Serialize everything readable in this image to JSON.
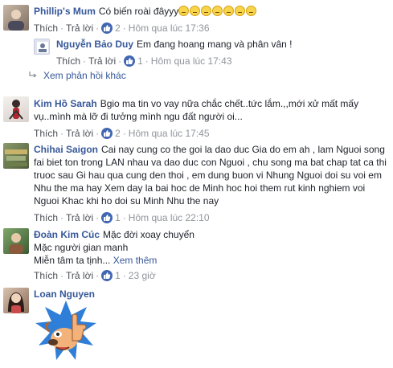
{
  "comments": [
    {
      "name": "Phillip's Mum",
      "text": "Có biến roài đâyyy",
      "emoji_count": 7,
      "like_label": "Thích",
      "reply_label": "Trả lời",
      "likes": "2",
      "time": "Hôm qua lúc 17:36"
    },
    {
      "name": "Nguyễn Bảo Duy",
      "text": "Em đang hoang mang và phân vân !",
      "like_label": "Thích",
      "reply_label": "Trả lời",
      "likes": "1",
      "time": "Hôm qua lúc 17:43"
    },
    {
      "name": "Kim Hồ Sarah",
      "text": "Bgio ma tin vo vay nữa chắc chết..tức lắm.,,mới xử mất mấy vụ..mình mà lỡ đi tưởng mình ngu đất người oi...",
      "like_label": "Thích",
      "reply_label": "Trả lời",
      "likes": "2",
      "time": "Hôm qua lúc 17:45"
    },
    {
      "name": "Chihai Saigon",
      "text": "Cai nay cung co the goi la dao duc Gia do em ah , lam Nguoi song fai biet ton trong LAN nhau va dao duc con Nguoi , chu song ma bat chap tat ca thi truoc sau Gi hau qua cung den thoi , em dung buon vi Nhung Nguoi doi su voi em Nhu the ma hay Xem day la bai hoc de Minh hoc hoi them rut kinh nghiem voi Nguoi Khac khi ho doi su Minh Nhu the nay",
      "like_label": "Thích",
      "reply_label": "Trả lời",
      "likes": "1",
      "time": "Hôm qua lúc 22:10"
    },
    {
      "name": "Đoàn Kim Cúc",
      "line1": "Mặc đời xoay chuyển",
      "line2": "Mặc người gian manh",
      "line3": "Miễn tâm ta tịnh...",
      "see_more": "Xem thêm",
      "like_label": "Thích",
      "reply_label": "Trả lời",
      "likes": "1",
      "time": "23 giờ"
    },
    {
      "name": "Loan Nguyen",
      "sticker": "thumbs-up-dog-sticker"
    }
  ],
  "view_more_replies": "Xem phản hồi khác",
  "colors": {
    "name": "#365899",
    "meta": "#90949c",
    "like_badge": "#4267b2"
  }
}
